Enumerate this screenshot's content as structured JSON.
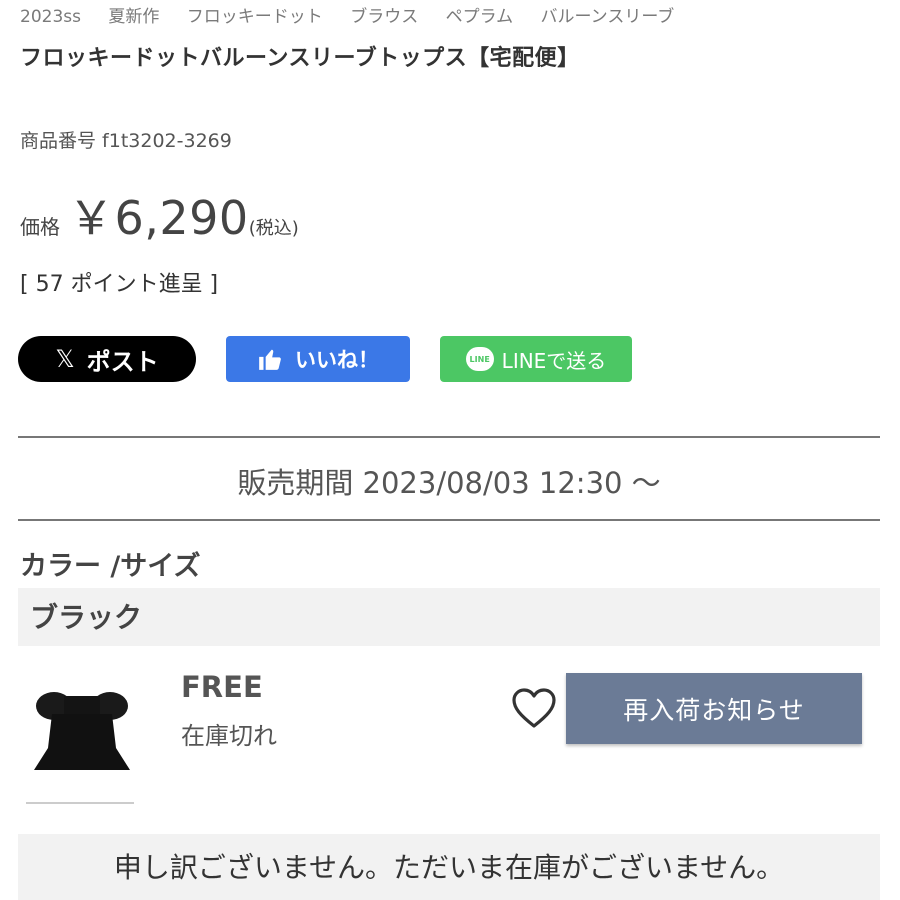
{
  "tags": [
    "2023ss",
    "夏新作",
    "フロッキードット",
    "ブラウス",
    "ペプラム",
    "バルーンスリーブ"
  ],
  "product": {
    "title": "フロッキードットバルーンスリーブトップス【宅配便】",
    "code": "商品番号 f1t3202-3269",
    "price_label": "価格",
    "price": "￥6,290",
    "tax_note": "(税込)",
    "points": "[ 57 ポイント進呈 ]"
  },
  "share": {
    "x_label": "ポスト",
    "fb_label": "いいね！",
    "line_label": "LINEで送る",
    "line_icon_text": "LINE"
  },
  "sale_period": "販売期間 2023/08/03 12:30 〜",
  "variants": {
    "heading": "カラー /サイズ",
    "color": "ブラック",
    "size": "FREE",
    "stock_status": "在庫切れ",
    "restock_button": "再入荷お知らせ"
  },
  "out_of_stock_message": "申し訳ございません。ただいま在庫がございません。",
  "colors": {
    "x": "#000000",
    "facebook": "#3b78e7",
    "line": "#4cc764",
    "restock": "#6b7b96"
  },
  "icons": [
    "x-logo-icon",
    "thumbs-up-icon",
    "line-logo-icon",
    "heart-icon"
  ]
}
